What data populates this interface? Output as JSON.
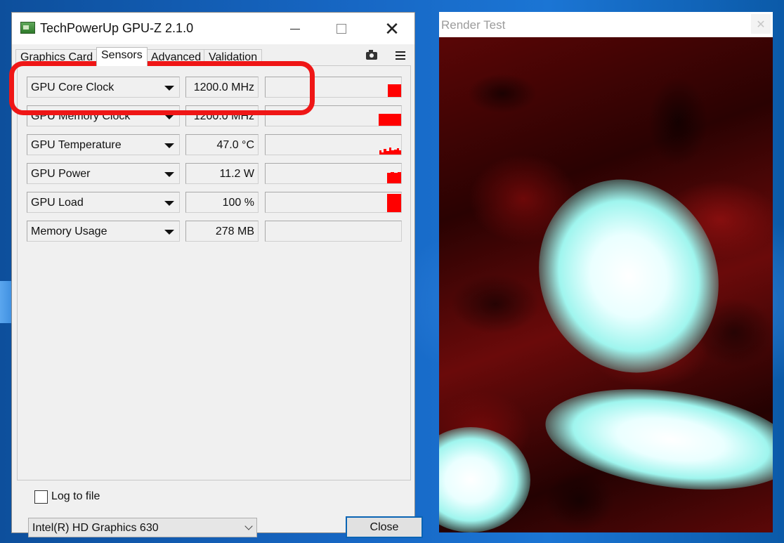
{
  "gpuz": {
    "title": "TechPowerUp GPU-Z 2.1.0",
    "tabs": [
      {
        "label": "Graphics Card"
      },
      {
        "label": "Sensors"
      },
      {
        "label": "Advanced"
      },
      {
        "label": "Validation"
      }
    ],
    "active_tab": "Sensors",
    "sensors": [
      {
        "name": "GPU Core Clock",
        "value": "1200.0 MHz"
      },
      {
        "name": "GPU Memory Clock",
        "value": "1200.0 MHz"
      },
      {
        "name": "GPU Temperature",
        "value": "47.0 °C"
      },
      {
        "name": "GPU Power",
        "value": "11.2 W"
      },
      {
        "name": "GPU Load",
        "value": "100 %"
      },
      {
        "name": "Memory Usage",
        "value": "278 MB"
      }
    ],
    "log_to_file_label": "Log to file",
    "log_to_file_checked": false,
    "gpu_selector_value": "Intel(R) HD Graphics 630",
    "close_label": "Close",
    "graph_color": "#ff0000",
    "highlight_color": "#ef1616"
  },
  "render_test": {
    "title": "Render Test",
    "close_glyph": "✕"
  },
  "icons": [
    "gpuz-app-icon",
    "minimize-icon",
    "maximize-icon",
    "close-icon",
    "camera-icon",
    "hamburger-menu-icon",
    "chevron-down-icon"
  ]
}
